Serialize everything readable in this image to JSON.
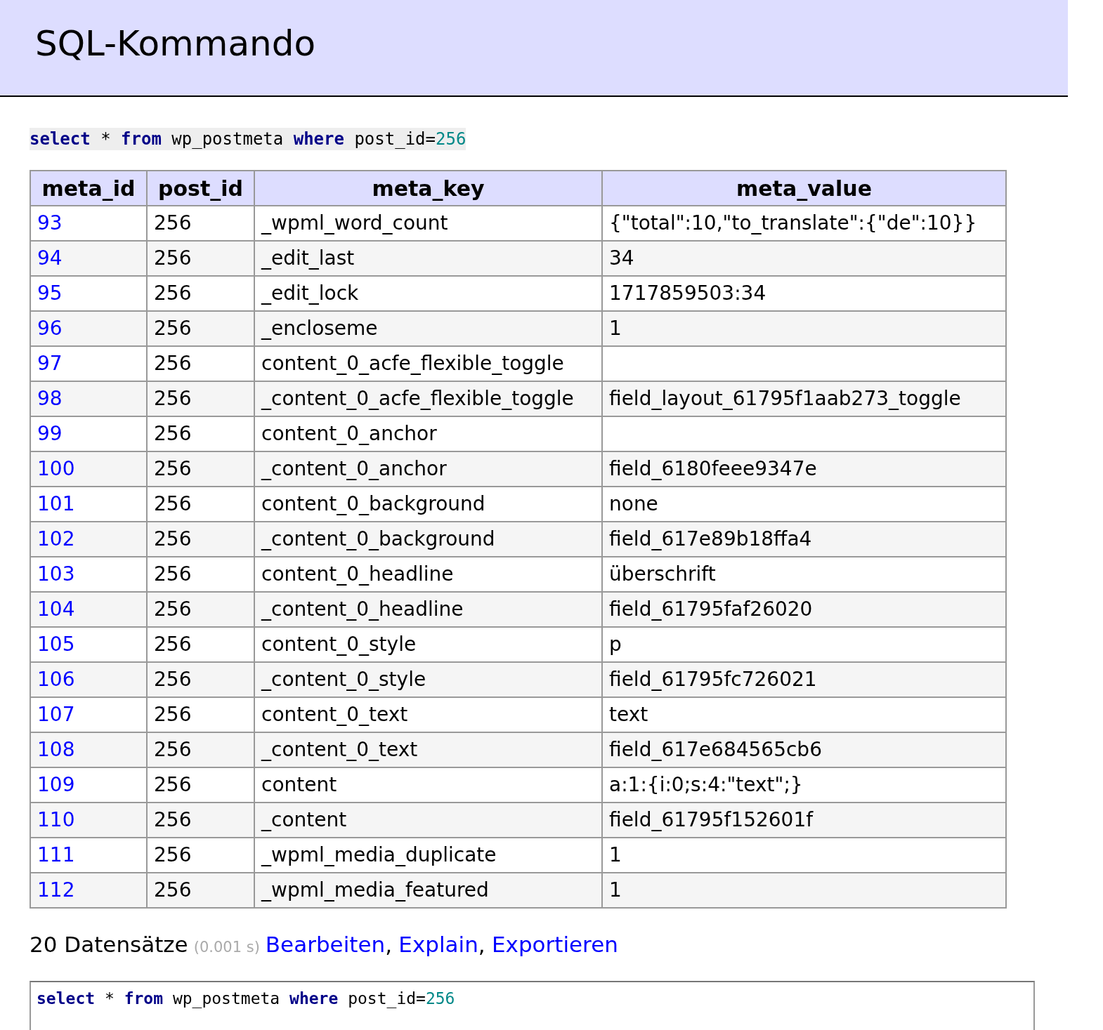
{
  "title": "SQL-Kommando",
  "query": {
    "tokens": [
      {
        "text": "select",
        "kind": "keyword"
      },
      {
        "text": " * ",
        "kind": "plain"
      },
      {
        "text": "from",
        "kind": "keyword"
      },
      {
        "text": " wp_postmeta ",
        "kind": "plain"
      },
      {
        "text": "where",
        "kind": "keyword"
      },
      {
        "text": " post_id=",
        "kind": "plain"
      },
      {
        "text": "256",
        "kind": "number"
      }
    ]
  },
  "table": {
    "columns": [
      "meta_id",
      "post_id",
      "meta_key",
      "meta_value"
    ],
    "rows": [
      [
        "93",
        "256",
        "_wpml_word_count",
        "{\"total\":10,\"to_translate\":{\"de\":10}}"
      ],
      [
        "94",
        "256",
        "_edit_last",
        "34"
      ],
      [
        "95",
        "256",
        "_edit_lock",
        "1717859503:34"
      ],
      [
        "96",
        "256",
        "_encloseme",
        "1"
      ],
      [
        "97",
        "256",
        "content_0_acfe_flexible_toggle",
        ""
      ],
      [
        "98",
        "256",
        "_content_0_acfe_flexible_toggle",
        "field_layout_61795f1aab273_toggle"
      ],
      [
        "99",
        "256",
        "content_0_anchor",
        ""
      ],
      [
        "100",
        "256",
        "_content_0_anchor",
        "field_6180feee9347e"
      ],
      [
        "101",
        "256",
        "content_0_background",
        "none"
      ],
      [
        "102",
        "256",
        "_content_0_background",
        "field_617e89b18ffa4"
      ],
      [
        "103",
        "256",
        "content_0_headline",
        "überschrift"
      ],
      [
        "104",
        "256",
        "_content_0_headline",
        "field_61795faf26020"
      ],
      [
        "105",
        "256",
        "content_0_style",
        "p"
      ],
      [
        "106",
        "256",
        "_content_0_style",
        "field_61795fc726021"
      ],
      [
        "107",
        "256",
        "content_0_text",
        "text"
      ],
      [
        "108",
        "256",
        "_content_0_text",
        "field_617e684565cb6"
      ],
      [
        "109",
        "256",
        "content",
        "a:1:{i:0;s:4:\"text\";}"
      ],
      [
        "110",
        "256",
        "_content",
        "field_61795f152601f"
      ],
      [
        "111",
        "256",
        "_wpml_media_duplicate",
        "1"
      ],
      [
        "112",
        "256",
        "_wpml_media_featured",
        "1"
      ]
    ]
  },
  "summary": {
    "count": "20 Datensätze",
    "time": "(0.001 s)",
    "links": [
      {
        "label": "Bearbeiten",
        "separator": ","
      },
      {
        "label": "Explain",
        "separator": ","
      },
      {
        "label": "Exportieren"
      }
    ]
  },
  "editor": {
    "tokens": [
      {
        "text": "select",
        "kind": "keyword"
      },
      {
        "text": " * ",
        "kind": "plain"
      },
      {
        "text": "from",
        "kind": "keyword"
      },
      {
        "text": " wp_postmeta ",
        "kind": "plain"
      },
      {
        "text": "where",
        "kind": "keyword"
      },
      {
        "text": " post_id=",
        "kind": "plain"
      },
      {
        "text": "256",
        "kind": "number"
      }
    ]
  }
}
